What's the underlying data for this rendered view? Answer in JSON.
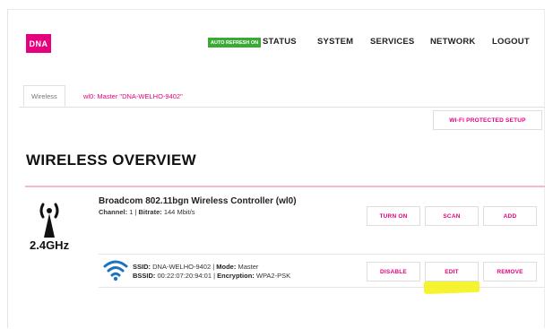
{
  "header": {
    "logo_text": "DNA",
    "autorefresh_label": "AUTO REFRESH ON",
    "nav": [
      "STATUS",
      "SYSTEM",
      "SERVICES",
      "NETWORK",
      "LOGOUT"
    ]
  },
  "tabs": {
    "active": "Wireless",
    "other": "wl0: Master \"DNA-WELHO-9402\""
  },
  "wps_button": "WI-FI PROTECTED SETUP",
  "page_title": "WIRELESS OVERVIEW",
  "controller": {
    "name": "Broadcom 802.11bgn Wireless Controller (wl0)",
    "channel_label": "Channel:",
    "channel": "1",
    "bitrate_label": "Bitrate:",
    "bitrate": "144 Mbit/s",
    "frequency": "2.4GHz",
    "buttons": {
      "turn_on": "TURN ON",
      "scan": "SCAN",
      "add": "ADD"
    }
  },
  "network": {
    "ssid_label": "SSID:",
    "ssid": "DNA-WELHO-9402",
    "mode_label": "Mode:",
    "mode": "Master",
    "bssid_label": "BSSID:",
    "bssid": "00:22:07:20:94:01",
    "encryption_label": "Encryption:",
    "encryption": "WPA2-PSK",
    "buttons": {
      "disable": "DISABLE",
      "edit": "EDIT",
      "remove": "REMOVE"
    }
  },
  "colors": {
    "brand": "#e6007e",
    "autorefresh": "#3aaa35",
    "wifi_icon": "#1e73be",
    "highlight": "#f5f21a"
  }
}
